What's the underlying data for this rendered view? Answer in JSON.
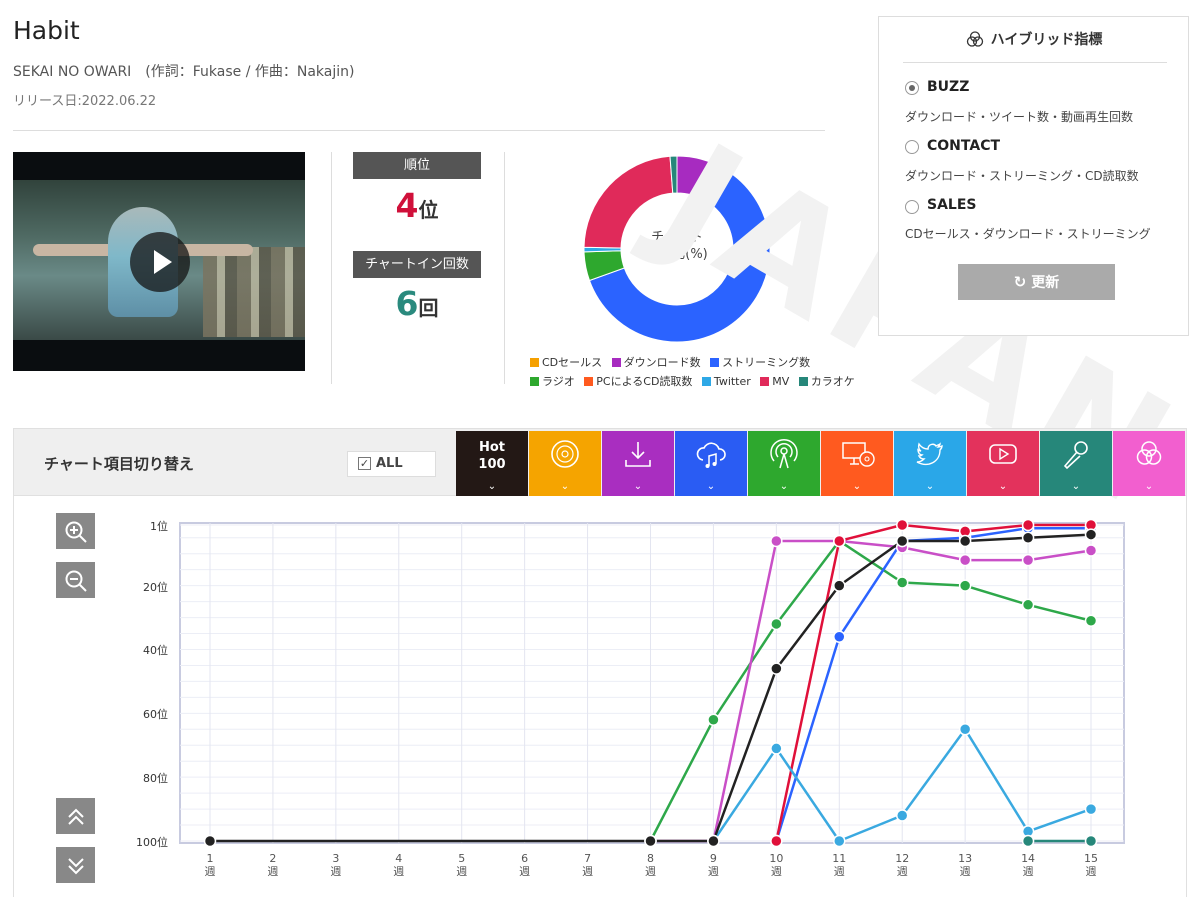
{
  "song": {
    "title": "Habit",
    "credit": "SEKAI NO OWARI　(作詞：Fukase / 作曲：Nakajin)",
    "release": "リリース日:2022.06.22"
  },
  "stats": {
    "rank_label": "順位",
    "rank_value": "4",
    "rank_unit": "位",
    "chartin_label": "チャートイン回数",
    "chartin_value": "6",
    "chartin_unit": "回",
    "rank_color": "#d0103a",
    "chartin_color": "#2a8a7e"
  },
  "composition": {
    "label_line1": "チャート",
    "label_line2": "構成比(%)",
    "legend": [
      {
        "name": "CDセールス",
        "color": "#f5a000"
      },
      {
        "name": "ダウンロード数",
        "color": "#a72bc0"
      },
      {
        "name": "ストリーミング数",
        "color": "#2b63ff"
      },
      {
        "name": "ラジオ",
        "color": "#2ea82e"
      },
      {
        "name": "PCによるCD読取数",
        "color": "#ff5a1f"
      },
      {
        "name": "Twitter",
        "color": "#2ea8e6"
      },
      {
        "name": "MV",
        "color": "#e02a5a"
      },
      {
        "name": "カラオケ",
        "color": "#26877a"
      }
    ],
    "slices": [
      {
        "name": "CDセールス",
        "value": 0
      },
      {
        "name": "ダウンロード数",
        "value": 8.5
      },
      {
        "name": "ストリーミング数",
        "value": 61
      },
      {
        "name": "ラジオ",
        "value": 5
      },
      {
        "name": "PCによるCD読取数",
        "value": 0
      },
      {
        "name": "Twitter",
        "value": 0.8
      },
      {
        "name": "MV",
        "value": 23.5
      },
      {
        "name": "カラオケ",
        "value": 1.2
      }
    ]
  },
  "hybrid": {
    "title": "ハイブリッド指標",
    "options": [
      {
        "name": "BUZZ",
        "desc": "ダウンロード・ツイート数・動画再生回数",
        "selected": true
      },
      {
        "name": "CONTACT",
        "desc": "ダウンロード・ストリーミング・CD読取数",
        "selected": false
      },
      {
        "name": "SALES",
        "desc": "CDセールス・ダウンロード・ストリーミング",
        "selected": false
      }
    ],
    "refresh_label": "更新"
  },
  "toolbar": {
    "label": "チャート項目切り替え",
    "all_label": "ALL",
    "hot_label_1": "Hot",
    "hot_label_2": "100",
    "chevron": "⌄",
    "tabs": [
      {
        "key": "hot100",
        "color": "#231815",
        "icon": "hot100-text"
      },
      {
        "key": "cd-sales",
        "color": "#f5a400",
        "icon": "disc-icon"
      },
      {
        "key": "download",
        "color": "#a92ec0",
        "icon": "download-icon"
      },
      {
        "key": "streaming",
        "color": "#2a5cf3",
        "icon": "cloud-music-icon"
      },
      {
        "key": "radio",
        "color": "#2ea82e",
        "icon": "radio-icon"
      },
      {
        "key": "pc-cd",
        "color": "#ff5a1f",
        "icon": "pc-disc-icon"
      },
      {
        "key": "twitter",
        "color": "#2aa7e8",
        "icon": "twitter-icon"
      },
      {
        "key": "mv",
        "color": "#e3325c",
        "icon": "play-icon"
      },
      {
        "key": "karaoke",
        "color": "#26877a",
        "icon": "mic-icon"
      },
      {
        "key": "hybrid",
        "color": "#f25fcf",
        "icon": "venn-icon"
      }
    ]
  },
  "chart_data": {
    "type": "line",
    "y_reversed": true,
    "ylim": [
      1,
      100
    ],
    "y_ticks": [
      {
        "v": 1,
        "label": "1位"
      },
      {
        "v": 20,
        "label": "20位"
      },
      {
        "v": 40,
        "label": "40位"
      },
      {
        "v": 60,
        "label": "60位"
      },
      {
        "v": 80,
        "label": "80位"
      },
      {
        "v": 100,
        "label": "100位"
      }
    ],
    "x": [
      1,
      2,
      3,
      4,
      5,
      6,
      7,
      8,
      9,
      10,
      11,
      12,
      13,
      14,
      15
    ],
    "x_unit": "週",
    "grid": true,
    "series": [
      {
        "key": "radio",
        "color": "#2ea84a",
        "points": [
          [
            8,
            100
          ],
          [
            9,
            62
          ],
          [
            10,
            32
          ],
          [
            11,
            6
          ],
          [
            12,
            19
          ],
          [
            13,
            20
          ],
          [
            14,
            26
          ],
          [
            15,
            31
          ]
        ]
      },
      {
        "key": "download",
        "color": "#c94fc7",
        "points": [
          [
            8,
            100
          ],
          [
            9,
            100
          ],
          [
            10,
            6
          ],
          [
            11,
            6
          ],
          [
            12,
            8
          ],
          [
            13,
            12
          ],
          [
            14,
            12
          ],
          [
            15,
            9
          ]
        ]
      },
      {
        "key": "streaming",
        "color": "#2b63ff",
        "points": [
          [
            10,
            100
          ],
          [
            11,
            36
          ],
          [
            12,
            6
          ],
          [
            13,
            5
          ],
          [
            14,
            2
          ],
          [
            15,
            2
          ]
        ]
      },
      {
        "key": "mv",
        "color": "#e0103a",
        "points": [
          [
            10,
            100
          ],
          [
            11,
            6
          ],
          [
            12,
            1
          ],
          [
            13,
            3
          ],
          [
            14,
            1
          ],
          [
            15,
            1
          ]
        ]
      },
      {
        "key": "twitter",
        "color": "#3aa9e0",
        "points": [
          [
            9,
            100
          ],
          [
            10,
            71
          ],
          [
            11,
            100
          ],
          [
            12,
            92
          ],
          [
            13,
            65
          ],
          [
            14,
            97
          ],
          [
            15,
            90
          ]
        ]
      },
      {
        "key": "karaoke",
        "color": "#26877a",
        "points": [
          [
            14,
            100
          ],
          [
            15,
            100
          ]
        ]
      },
      {
        "key": "hot100",
        "color": "#222222",
        "points": [
          [
            1,
            100
          ],
          [
            8,
            100
          ],
          [
            9,
            100
          ],
          [
            10,
            46
          ],
          [
            11,
            20
          ],
          [
            12,
            6
          ],
          [
            13,
            6
          ],
          [
            14,
            5
          ],
          [
            15,
            4
          ]
        ]
      }
    ]
  }
}
